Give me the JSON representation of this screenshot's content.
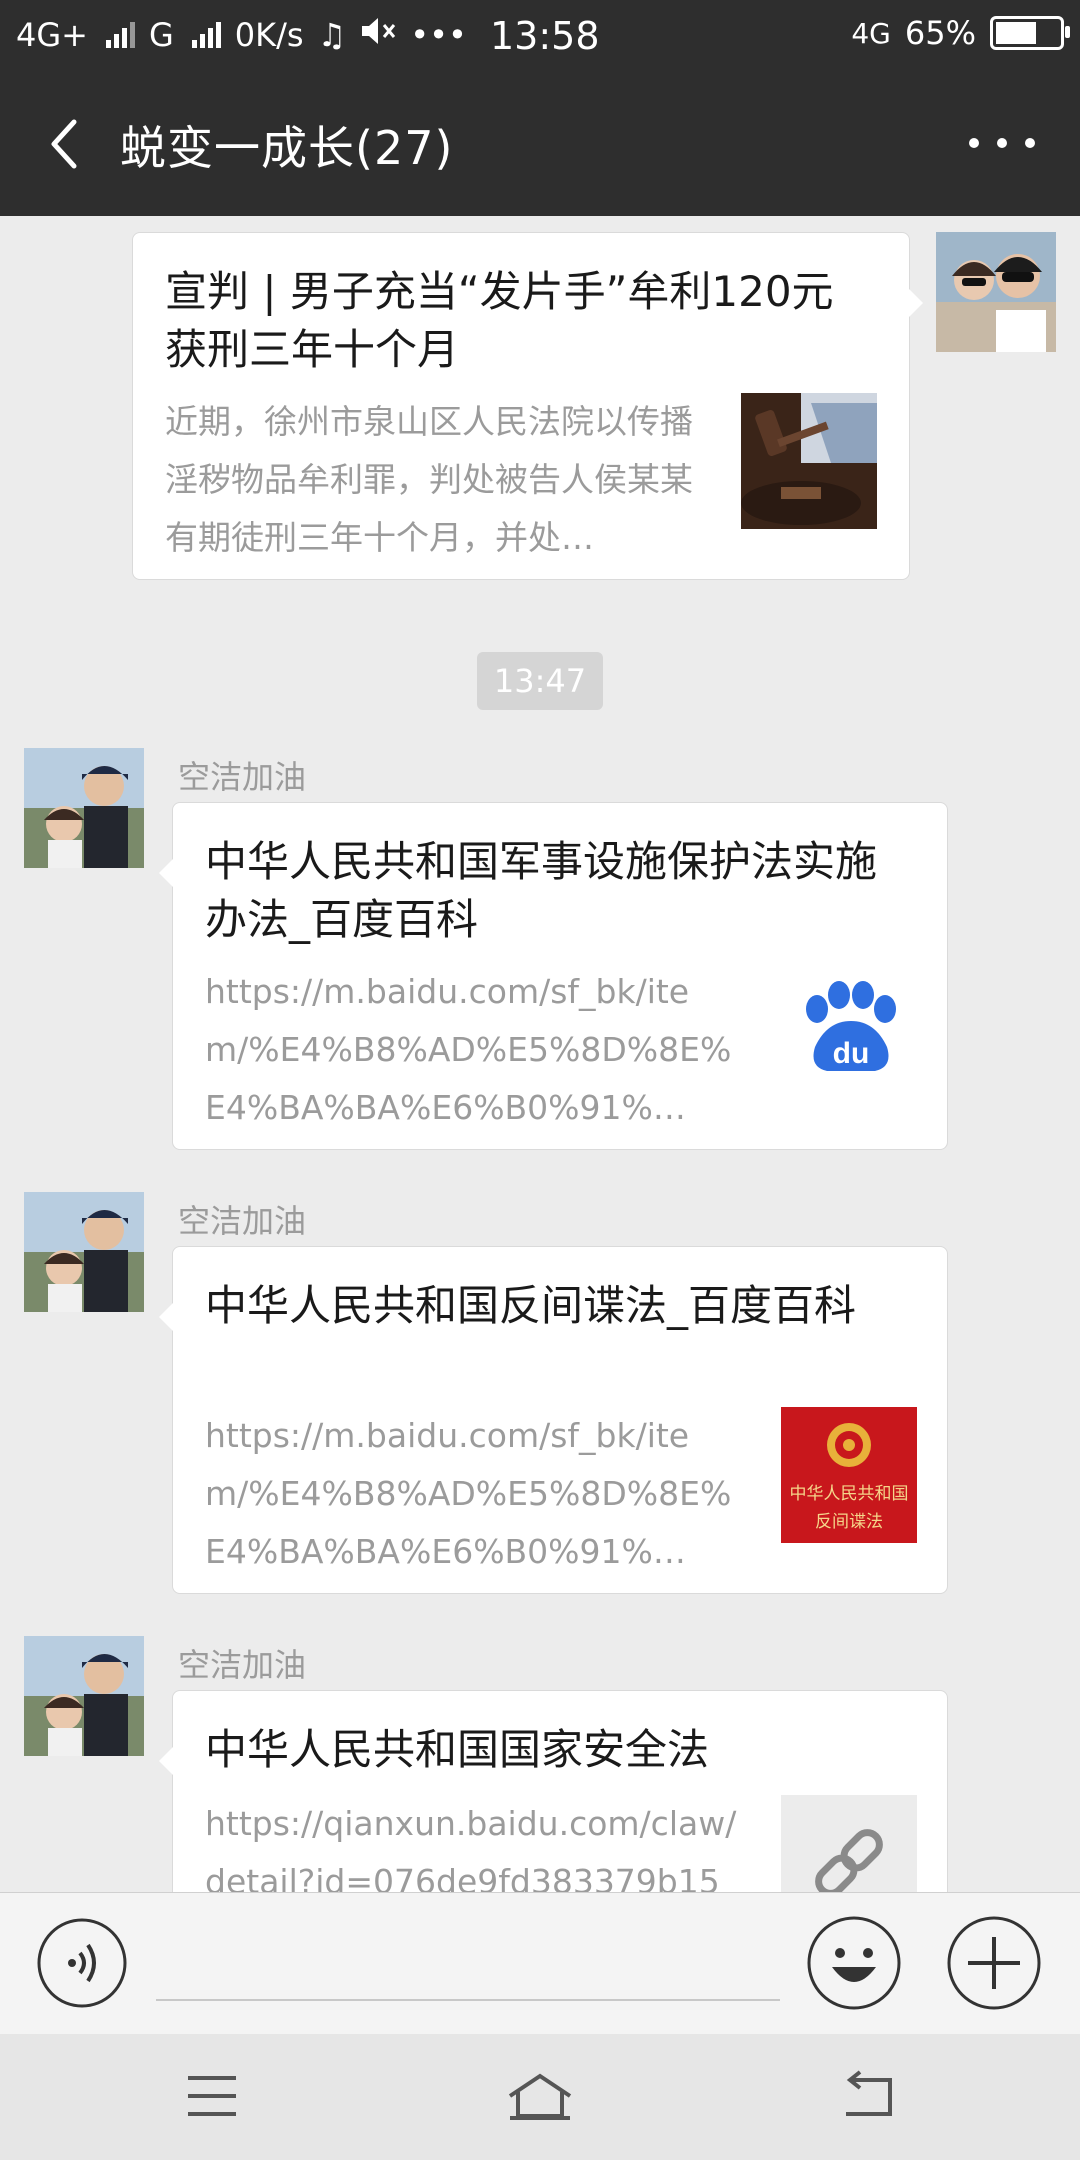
{
  "status_bar": {
    "network_left": "4G+",
    "network_g": "G",
    "speed": "0K/s",
    "time": "13:58",
    "network_right": "4G",
    "battery_percent": "65%",
    "battery_level": 0.65
  },
  "header": {
    "title": "蜕变一成长(27)"
  },
  "messages": [
    {
      "type": "link",
      "side": "right",
      "title": "宣判 | 男子充当“发片手”牟利120元  获刑三年十个月",
      "desc": "近期，徐州市泉山区人民法院以传播淫秽物品牟利罪，判处被告人侯某某有期徒刑三年十个月，并处…",
      "thumb": "gavel-photo"
    },
    {
      "type": "time",
      "text": "13:47"
    },
    {
      "type": "link",
      "side": "left",
      "sender": "空洁加油",
      "title": "中华人民共和国军事设施保护法实施办法_百度百科",
      "desc": "https://m.baidu.com/sf_bk/item/%E4%B8%AD%E5%8D%8E%E4%BA%BA%E6%B0%91%…",
      "thumb": "baidu-logo"
    },
    {
      "type": "link",
      "side": "left",
      "sender": "空洁加油",
      "title": "中华人民共和国反间谍法_百度百科",
      "desc": "https://m.baidu.com/sf_bk/item/%E4%B8%AD%E5%8D%8E%E4%BA%BA%E6%B0%91%…",
      "thumb": "law-book-cover",
      "thumb_text_1": "中华人民共和国",
      "thumb_text_2": "反间谍法"
    },
    {
      "type": "link",
      "side": "left",
      "sender": "空洁加油",
      "title": "中华人民共和国国家安全法",
      "desc": "https://qianxun.baidu.com/claw/detail?id=076de9fd383379b15",
      "thumb": "link-icon"
    }
  ],
  "input_bar": {
    "voice_icon": "voice-icon",
    "emoji_icon": "emoji-icon",
    "plus_icon": "plus-icon"
  },
  "system_nav": {
    "menu_icon": "menu-icon",
    "home_icon": "home-icon",
    "back_icon": "back-icon"
  }
}
